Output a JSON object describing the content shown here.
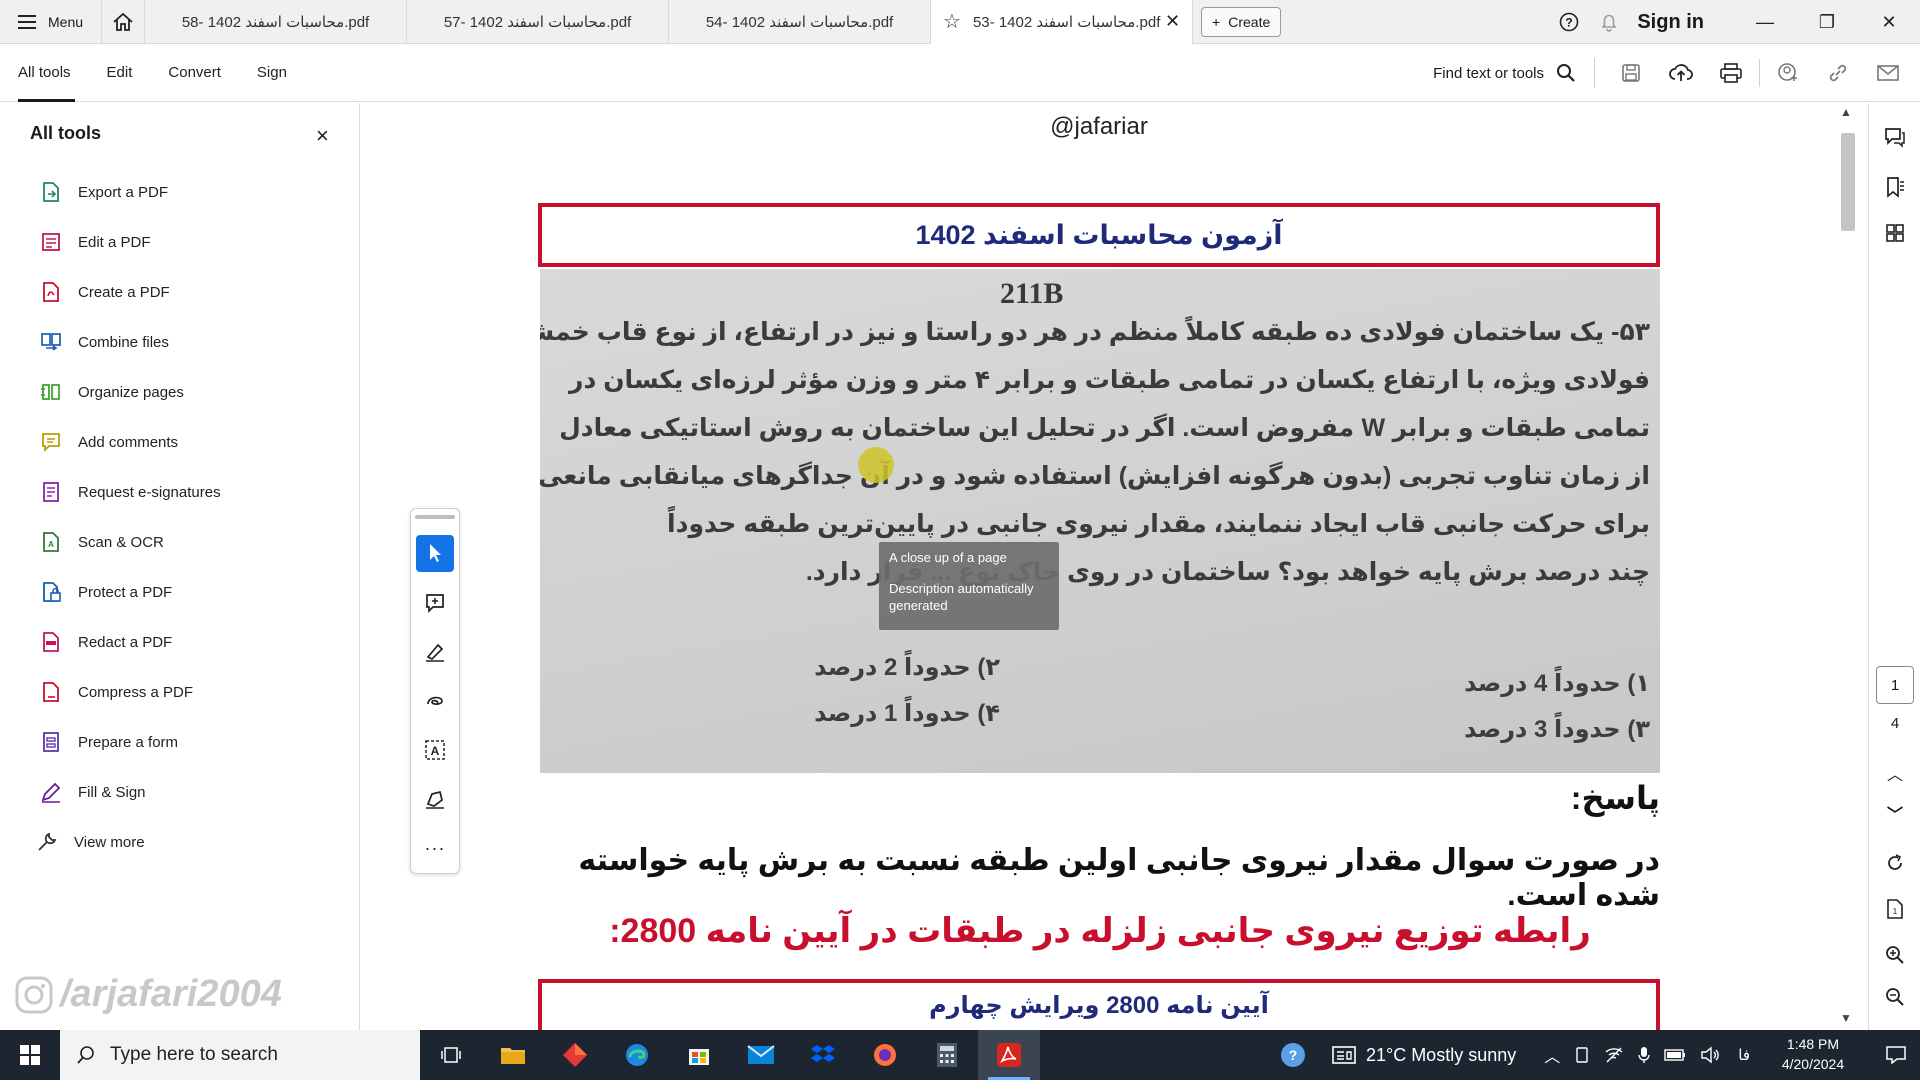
{
  "titlebar": {
    "menu_label": "Menu",
    "tabs": [
      {
        "label": "محاسبات اسفند 1402 -58.pdf"
      },
      {
        "label": "محاسبات اسفند 1402 -57.pdf"
      },
      {
        "label": "محاسبات اسفند 1402 -54.pdf"
      },
      {
        "label": "محاسبات اسفند 1402 -53.pdf"
      }
    ],
    "create_label": "Create",
    "sign_in_label": "Sign in"
  },
  "toolbar": {
    "tabs": [
      "All tools",
      "Edit",
      "Convert",
      "Sign"
    ],
    "find_label": "Find text or tools"
  },
  "left_panel": {
    "title": "All tools",
    "items": [
      {
        "label": "Export a PDF",
        "icon": "export-pdf-icon"
      },
      {
        "label": "Edit a PDF",
        "icon": "edit-pdf-icon"
      },
      {
        "label": "Create a PDF",
        "icon": "create-pdf-icon"
      },
      {
        "label": "Combine files",
        "icon": "combine-files-icon"
      },
      {
        "label": "Organize pages",
        "icon": "organize-pages-icon"
      },
      {
        "label": "Add comments",
        "icon": "add-comments-icon"
      },
      {
        "label": "Request e-signatures",
        "icon": "request-esign-icon"
      },
      {
        "label": "Scan & OCR",
        "icon": "scan-ocr-icon"
      },
      {
        "label": "Protect a PDF",
        "icon": "protect-pdf-icon"
      },
      {
        "label": "Redact a PDF",
        "icon": "redact-pdf-icon"
      },
      {
        "label": "Compress a PDF",
        "icon": "compress-pdf-icon"
      },
      {
        "label": "Prepare a form",
        "icon": "prepare-form-icon"
      },
      {
        "label": "Fill & Sign",
        "icon": "fill-sign-icon"
      }
    ],
    "view_more_label": "View more",
    "watermark": "/arjafari2004"
  },
  "document": {
    "handle": "@jafariar",
    "title_box": "آزمون محاسبات اسفند 1402",
    "scan": {
      "code": "211B",
      "lines": [
        "۵۳- یک ساختمان فولادی ده طبقه کاملاً منظم در هر دو راستا و نیز در ارتفاع، از نوع قاب خمشی",
        "فولادی ویژه، با ارتفاع یکسان در تمامی طبقات و برابر ۴ متر و وزن مؤثر لرزه‌ای یکسان در",
        "تمامی طبقات و برابر W مفروض است. اگر در تحلیل این ساختمان به روش استاتیکی معادل",
        "از زمان تناوب تجربی (بدون هرگونه افزایش) استفاده شود و در آن جداگرهای میانقابی مانعی",
        "برای حرکت جانبی قاب ایجاد ننمایند، مقدار نیروی جانبی در پایین‌ترین طبقه حدوداً",
        "چند درصد برش پایه خواهد بود؟ ساختمان در روی خاک نوع ... قرار دارد."
      ],
      "options": [
        "۱) حدوداً 4 درصد",
        "۲) حدوداً 2 درصد",
        "۳) حدوداً 3 درصد",
        "۴) حدوداً 1 درصد"
      ]
    },
    "tooltip": {
      "line1": "A close up of a page",
      "line2": "Description automatically generated"
    },
    "answer_heading": "پاسخ:",
    "answer_text": "در صورت سوال مقدار نیروی جانبی اولین طبقه نسبت به برش پایه خواسته شده است.",
    "answer_red": "رابطه توزیع نیروی جانبی زلزله در طبقات در آیین نامه 2800:",
    "code_box": "آیین نامه 2800 ویرایش چهارم"
  },
  "page_nav": {
    "current": "1",
    "total": "4"
  },
  "taskbar": {
    "search_placeholder": "Type here to search",
    "weather": "21°C  Mostly sunny",
    "lang": "فا",
    "time": "1:48 PM",
    "date": "4/20/2024"
  }
}
